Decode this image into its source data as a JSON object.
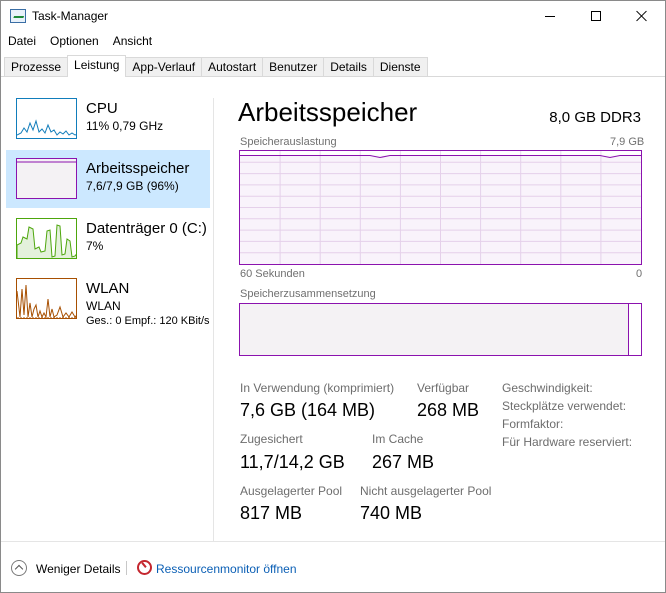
{
  "window": {
    "title": "Task-Manager"
  },
  "menu": [
    "Datei",
    "Optionen",
    "Ansicht"
  ],
  "tabs": [
    "Prozesse",
    "Leistung",
    "App-Verlauf",
    "Autostart",
    "Benutzer",
    "Details",
    "Dienste"
  ],
  "active_tab": "Leistung",
  "sidebar": {
    "items": [
      {
        "title": "CPU",
        "sub": "11%  0,79 GHz",
        "color": "#117dbb"
      },
      {
        "title": "Arbeitsspeicher",
        "sub": "7,6/7,9 GB (96%)",
        "color": "#8b12ae",
        "selected": true
      },
      {
        "title": "Datenträger 0 (C:)",
        "sub": "7%",
        "color": "#4da60c"
      },
      {
        "title": "WLAN",
        "sub": "WLAN",
        "sub2": "Ges.: 0  Empf.: 120 KBit/s",
        "color": "#a74f01"
      }
    ]
  },
  "main": {
    "title": "Arbeitsspeicher",
    "spec": "8,0 GB DDR3",
    "usage_label": "Speicherauslastung",
    "usage_max": "7,9 GB",
    "time_left": "60 Sekunden",
    "time_right": "0",
    "composition_label": "Speicherzusammensetzung",
    "usage_fraction": 0.96,
    "stats": {
      "in_use_label": "In Verwendung (komprimiert)",
      "in_use_value": "7,6 GB (164 MB)",
      "available_label": "Verfügbar",
      "available_value": "268 MB",
      "committed_label": "Zugesichert",
      "committed_value": "11,7/14,2 GB",
      "cached_label": "Im Cache",
      "cached_value": "267 MB",
      "paged_label": "Ausgelagerter Pool",
      "paged_value": "817 MB",
      "nonpaged_label": "Nicht ausgelagerter Pool",
      "nonpaged_value": "740 MB"
    },
    "info": {
      "speed_label": "Geschwindigkeit:",
      "slots_label": "Steckplätze verwendet:",
      "form_label": "Formfaktor:",
      "reserved_label": "Für Hardware reserviert:"
    }
  },
  "footer": {
    "fewer_details": "Weniger Details",
    "resmon": "Ressourcenmonitor öffnen"
  }
}
